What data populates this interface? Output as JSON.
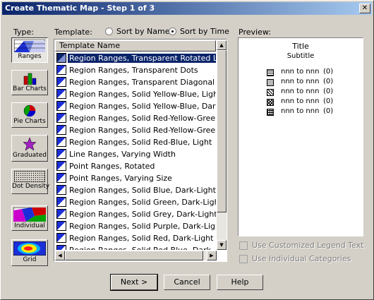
{
  "window": {
    "title": "Create Thematic Map - Step 1 of 3",
    "close_glyph": "✕"
  },
  "type_label": "Type:",
  "template_label": "Template:",
  "sort": {
    "by_name": "Sort by Name",
    "by_time": "Sort by Time",
    "selected": "time"
  },
  "types": [
    {
      "label": "Ranges",
      "icon": "ranges-icon",
      "active": true
    },
    {
      "label": "Bar Charts",
      "icon": "bar-chart-icon",
      "active": false
    },
    {
      "label": "Pie Charts",
      "icon": "pie-chart-icon",
      "active": false
    },
    {
      "label": "Graduated",
      "icon": "graduated-symbol-icon",
      "active": false
    },
    {
      "label": "Dot Density",
      "icon": "dot-density-icon",
      "active": false
    },
    {
      "label": "Individual",
      "icon": "individual-value-icon",
      "active": false
    },
    {
      "label": "Grid",
      "icon": "grid-icon",
      "active": false
    }
  ],
  "list": {
    "header": "Template Name",
    "selected_index": 0,
    "items": [
      "Region Ranges, Transparent Rotated Lines",
      "Region Ranges, Transparent Dots",
      "Region Ranges, Transparent Diagonal Lines",
      "Region Ranges, Solid Yellow-Blue, Light",
      "Region Ranges, Solid Yellow-Blue, Dark",
      "Region Ranges, Solid Red-Yellow-Green, Lig",
      "Region Ranges, Solid Red-Yellow-Green, Da",
      "Region Ranges, Solid Red-Blue, Light",
      "Line Ranges, Varying Width",
      "Point Ranges, Rotated",
      "Point Ranges, Varying Size",
      "Region Ranges, Solid Blue, Dark-Light",
      "Region Ranges, Solid Green, Dark-Light",
      "Region Ranges, Solid Grey, Dark-Light",
      "Region Ranges, Solid Purple, Dark-Light",
      "Region Ranges, Solid Red, Dark-Light",
      "Region Ranges, Solid Red-Blue, Dark"
    ]
  },
  "preview": {
    "label": "Preview:",
    "title": "Title",
    "subtitle": "Subtitle",
    "legend": [
      {
        "range": "nnn to nnn",
        "count": "(0)",
        "pattern": "horizontal-lines"
      },
      {
        "range": "nnn to nnn",
        "count": "(0)",
        "pattern": "dots"
      },
      {
        "range": "nnn to nnn",
        "count": "(0)",
        "pattern": "diagonal-lines"
      },
      {
        "range": "nnn to nnn",
        "count": "(0)",
        "pattern": "cross-diagonal"
      },
      {
        "range": "nnn to nnn",
        "count": "(0)",
        "pattern": "grid"
      }
    ]
  },
  "options": {
    "custom_legend": "Use Customized Legend Text",
    "individual_categories": "Use Individual Categories"
  },
  "buttons": {
    "next": "Next >",
    "cancel": "Cancel",
    "help": "Help"
  },
  "colors": {
    "selection": "#0a246a",
    "accent_blue": "#1b2fd8",
    "face": "#d4d0c8"
  }
}
